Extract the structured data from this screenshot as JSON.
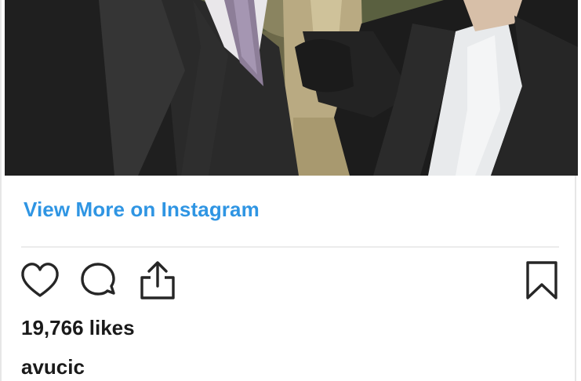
{
  "post": {
    "image_alt": "",
    "view_more_label": "View More on Instagram",
    "likes_text": "19,766 likes",
    "username": "avucic"
  },
  "actions": {
    "like_icon": "heart-outline",
    "comment_icon": "speech-bubble-outline",
    "share_icon": "share-upload",
    "save_icon": "bookmark-outline"
  },
  "colors": {
    "link": "#2f95e3",
    "text": "#1a1a1a",
    "divider": "#ececec"
  }
}
